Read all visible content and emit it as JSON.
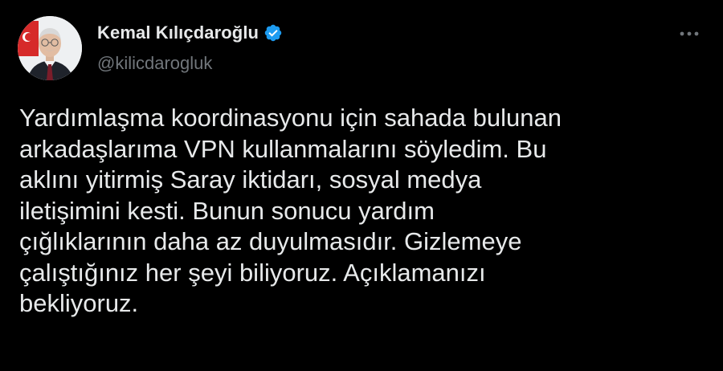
{
  "author": {
    "display_name": "Kemal Kılıçdaroğlu",
    "handle": "@kilicdarogluk",
    "verified": true,
    "verified_icon": "verified-badge-icon",
    "avatar_icon": "profile-photo"
  },
  "tweet": {
    "text": "Yardımlaşma koordinasyonu için sahada bulunan\narkadaşlarıma VPN kullanmalarını söyledim. Bu\naklını yitirmiş Saray iktidarı, sosyal medya\niletişimini kesti. Bunun sonucu yardım\nçığlıklarının daha az duyulmasıdır. Gizlemeye\nçalıştığınız her şeyi biliyoruz. Açıklamanızı\nbekliyoruz."
  },
  "menu": {
    "icon": "more-horizontal-icon"
  },
  "colors": {
    "background": "#000000",
    "text_primary": "#e7e9ea",
    "text_secondary": "#71767b",
    "verified_blue": "#1d9bf0"
  }
}
